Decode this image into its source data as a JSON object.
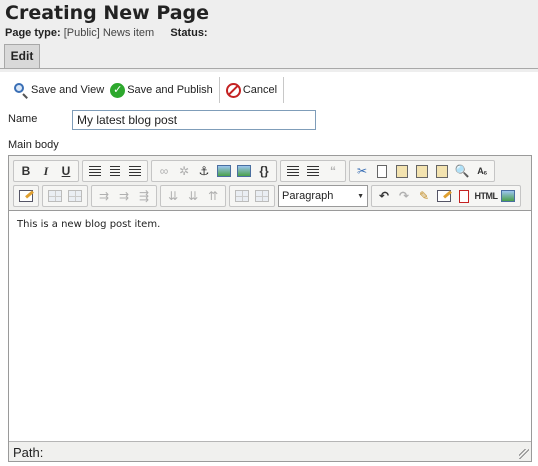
{
  "header": {
    "title": "Creating New Page",
    "page_type_label": "Page type:",
    "page_type_value": "[Public] News item",
    "status_label": "Status:",
    "tab_edit": "Edit"
  },
  "actions": {
    "save_view": "Save and View",
    "save_publish": "Save and Publish",
    "cancel": "Cancel"
  },
  "form": {
    "name_label": "Name",
    "name_value": "My latest blog post",
    "body_label": "Main body"
  },
  "editor": {
    "toolbar": {
      "bold": "B",
      "italic": "I",
      "underline": "U",
      "source": "{}",
      "blockquote": "“",
      "html": "HTML",
      "format_select": "Paragraph"
    },
    "content": "This is a new blog post item.",
    "path_label": "Path:"
  }
}
